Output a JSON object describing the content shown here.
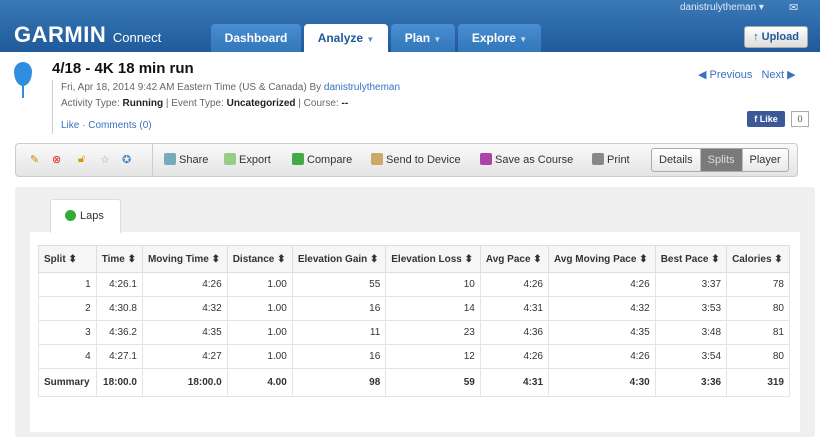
{
  "header": {
    "logo": "GARMIN",
    "logo_sub": "Connect",
    "user": "danistrulytheman",
    "tabs": [
      {
        "label": "Dashboard"
      },
      {
        "label": "Analyze"
      },
      {
        "label": "Plan"
      },
      {
        "label": "Explore"
      }
    ],
    "upload": "Upload"
  },
  "activity": {
    "title": "4/18 - 4K 18 min run",
    "date": "Fri, Apr 18, 2014 9:42 AM Eastern Time (US & Canada) By ",
    "author": "danistrulytheman",
    "type_label": "Activity Type: ",
    "type": "Running",
    "event_label": " | Event Type: ",
    "event": "Uncategorized",
    "course_label": " | Course: ",
    "course": "--",
    "like": "Like",
    "comments": "Comments (0)",
    "previous": "Previous",
    "next": "Next",
    "fb_like": "Like",
    "fb_count": "0"
  },
  "toolbar": {
    "share": "Share",
    "export": "Export",
    "compare": "Compare",
    "send": "Send to Device",
    "save_course": "Save as Course",
    "print": "Print",
    "views": [
      "Details",
      "Splits",
      "Player"
    ]
  },
  "laps_tab": "Laps",
  "table": {
    "headers": [
      "Split",
      "Time",
      "Moving Time",
      "Distance",
      "Elevation Gain",
      "Elevation Loss",
      "Avg Pace",
      "Avg Moving Pace",
      "Best Pace",
      "Calories"
    ],
    "rows": [
      [
        "1",
        "4:26.1",
        "4:26",
        "1.00",
        "55",
        "10",
        "4:26",
        "4:26",
        "3:37",
        "78"
      ],
      [
        "2",
        "4:30.8",
        "4:32",
        "1.00",
        "16",
        "14",
        "4:31",
        "4:32",
        "3:53",
        "80"
      ],
      [
        "3",
        "4:36.2",
        "4:35",
        "1.00",
        "11",
        "23",
        "4:36",
        "4:35",
        "3:48",
        "81"
      ],
      [
        "4",
        "4:27.1",
        "4:27",
        "1.00",
        "16",
        "12",
        "4:26",
        "4:26",
        "3:54",
        "80"
      ]
    ],
    "summary": [
      "Summary",
      "18:00.0",
      "18:00.0",
      "4.00",
      "98",
      "59",
      "4:31",
      "4:30",
      "3:36",
      "319"
    ]
  }
}
